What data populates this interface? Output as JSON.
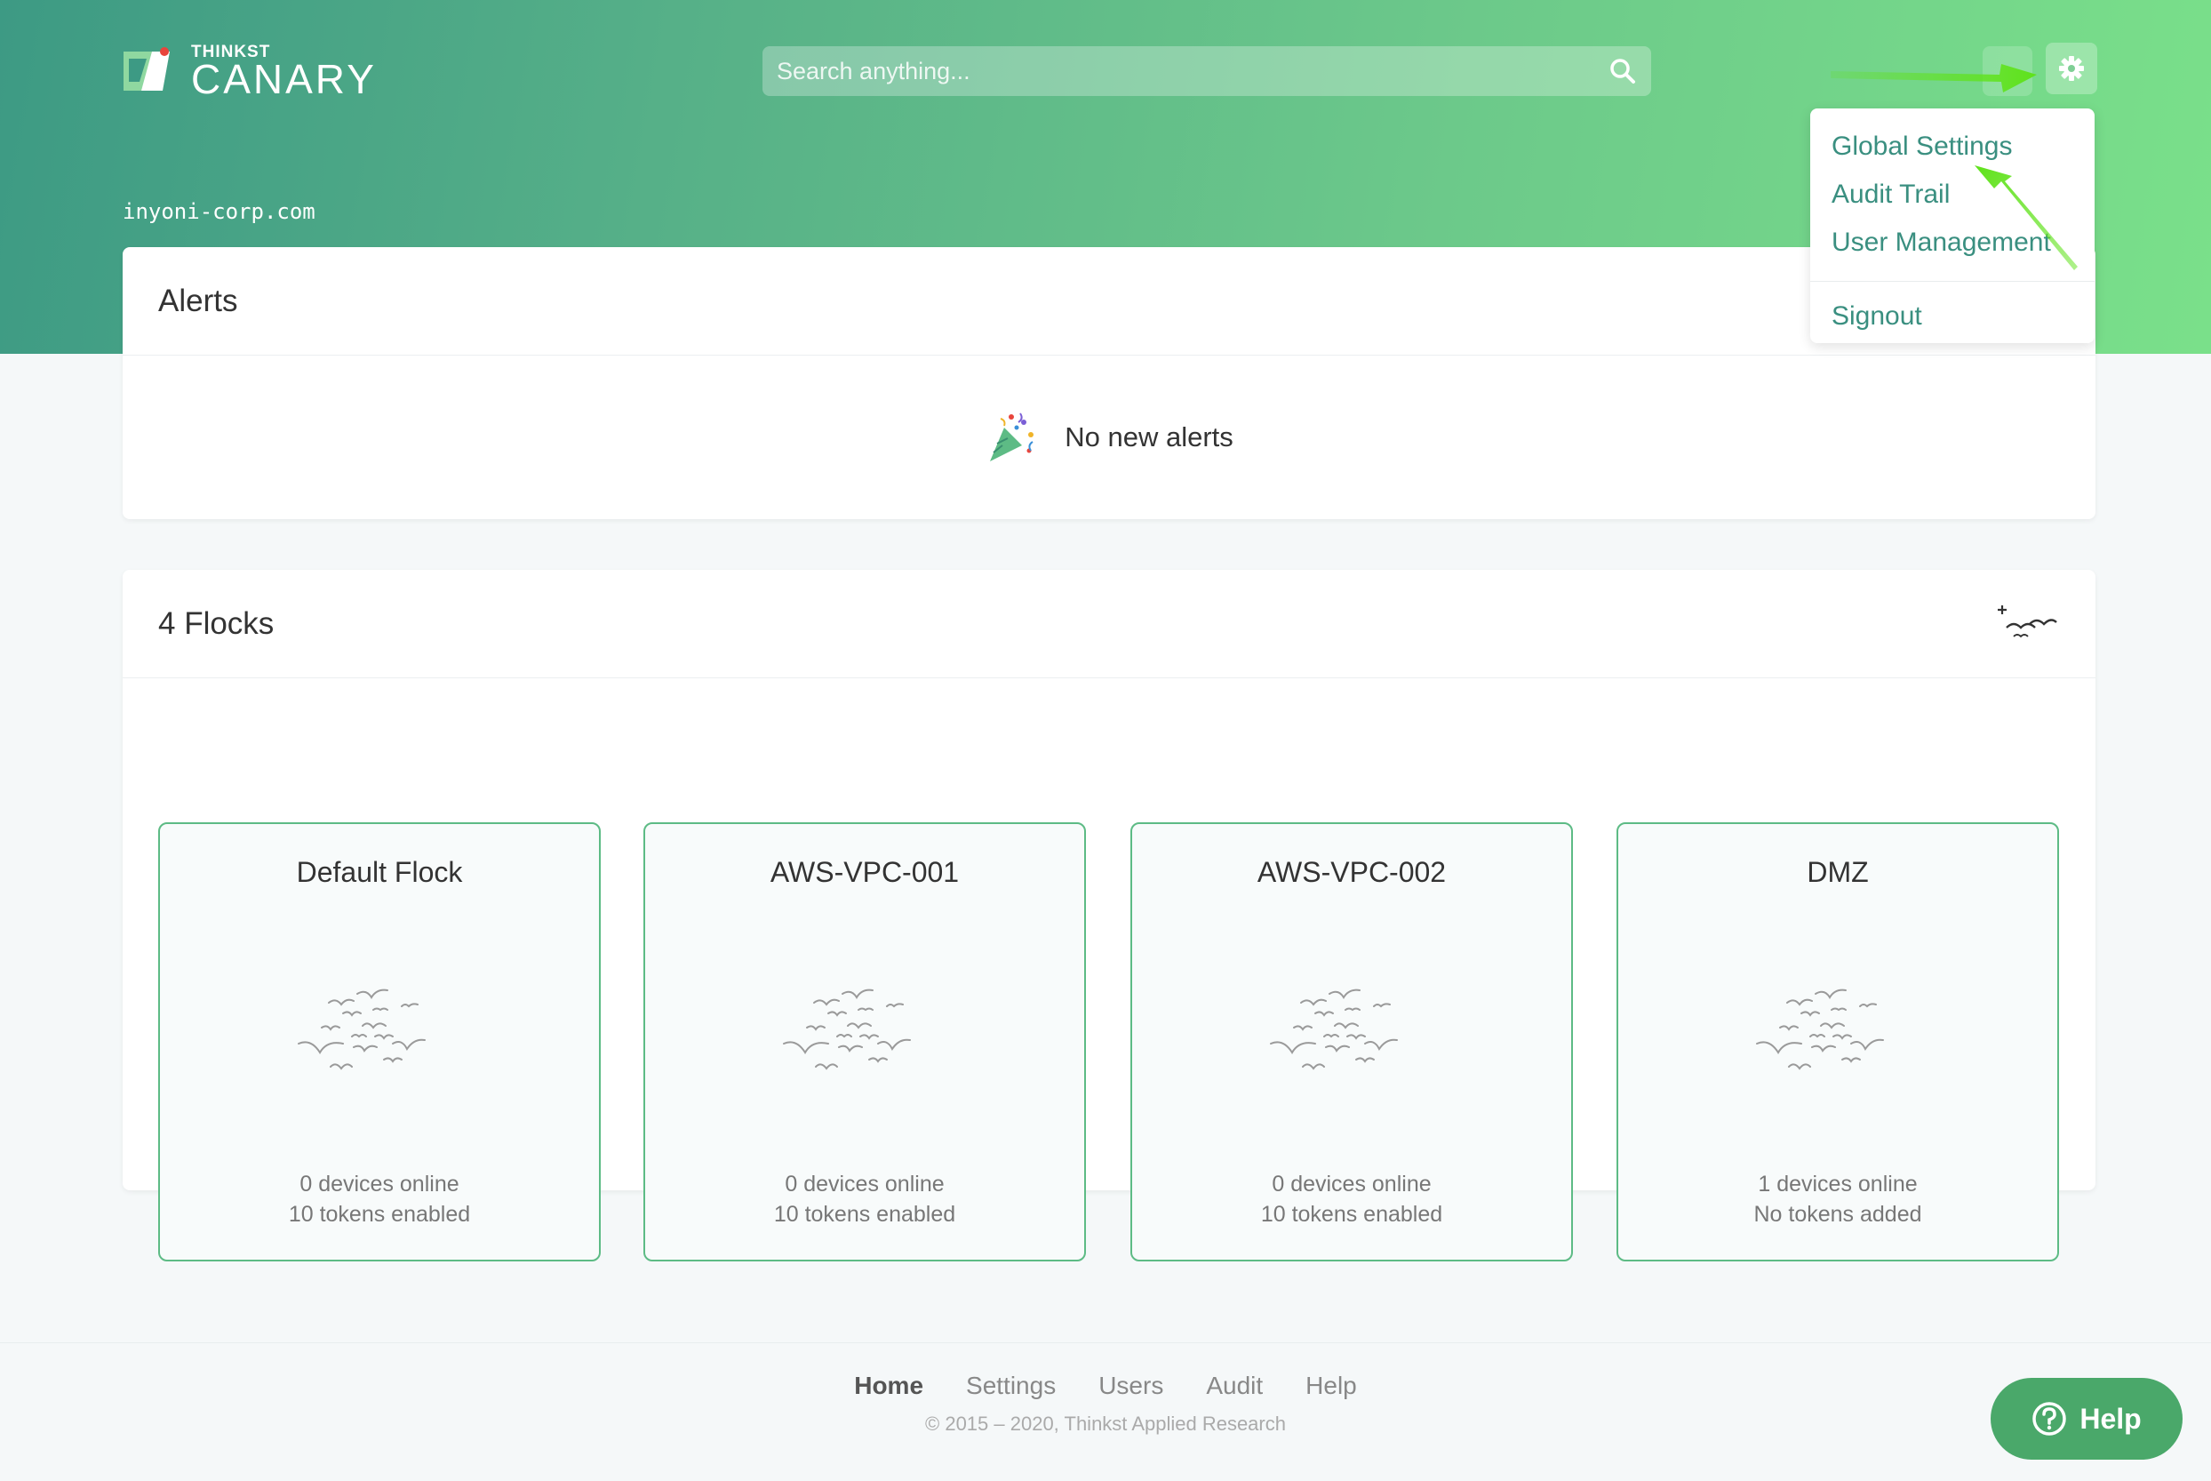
{
  "header": {
    "logo_top": "THINKST",
    "logo_main": "CANARY",
    "domain": "inyoni-corp.com"
  },
  "search": {
    "placeholder": "Search anything..."
  },
  "settings_menu": {
    "items": [
      {
        "label": "Global Settings"
      },
      {
        "label": "Audit Trail"
      },
      {
        "label": "User Management"
      }
    ],
    "signout": "Signout"
  },
  "alerts": {
    "title": "Alerts",
    "empty_text": "No new alerts",
    "empty_icon": "party-popper-icon"
  },
  "flocks": {
    "title": "4 Flocks",
    "add_icon": "add-flock-icon",
    "items": [
      {
        "name": "Default Flock",
        "devices": "0 devices online",
        "tokens": "10 tokens enabled"
      },
      {
        "name": "AWS-VPC-001",
        "devices": "0 devices online",
        "tokens": "10 tokens enabled"
      },
      {
        "name": "AWS-VPC-002",
        "devices": "0 devices online",
        "tokens": "10 tokens enabled"
      },
      {
        "name": "DMZ",
        "devices": "1 devices online",
        "tokens": "No tokens added"
      }
    ]
  },
  "footer": {
    "nav": [
      "Home",
      "Settings",
      "Users",
      "Audit",
      "Help"
    ],
    "copyright": "© 2015 – 2020, Thinkst Applied Research"
  },
  "help_button": {
    "label": "Help"
  },
  "colors": {
    "accent": "#4aa86a",
    "link": "#3a8f80",
    "flock_border": "#5dbb85",
    "annotation_arrow": "#5fe21a"
  }
}
